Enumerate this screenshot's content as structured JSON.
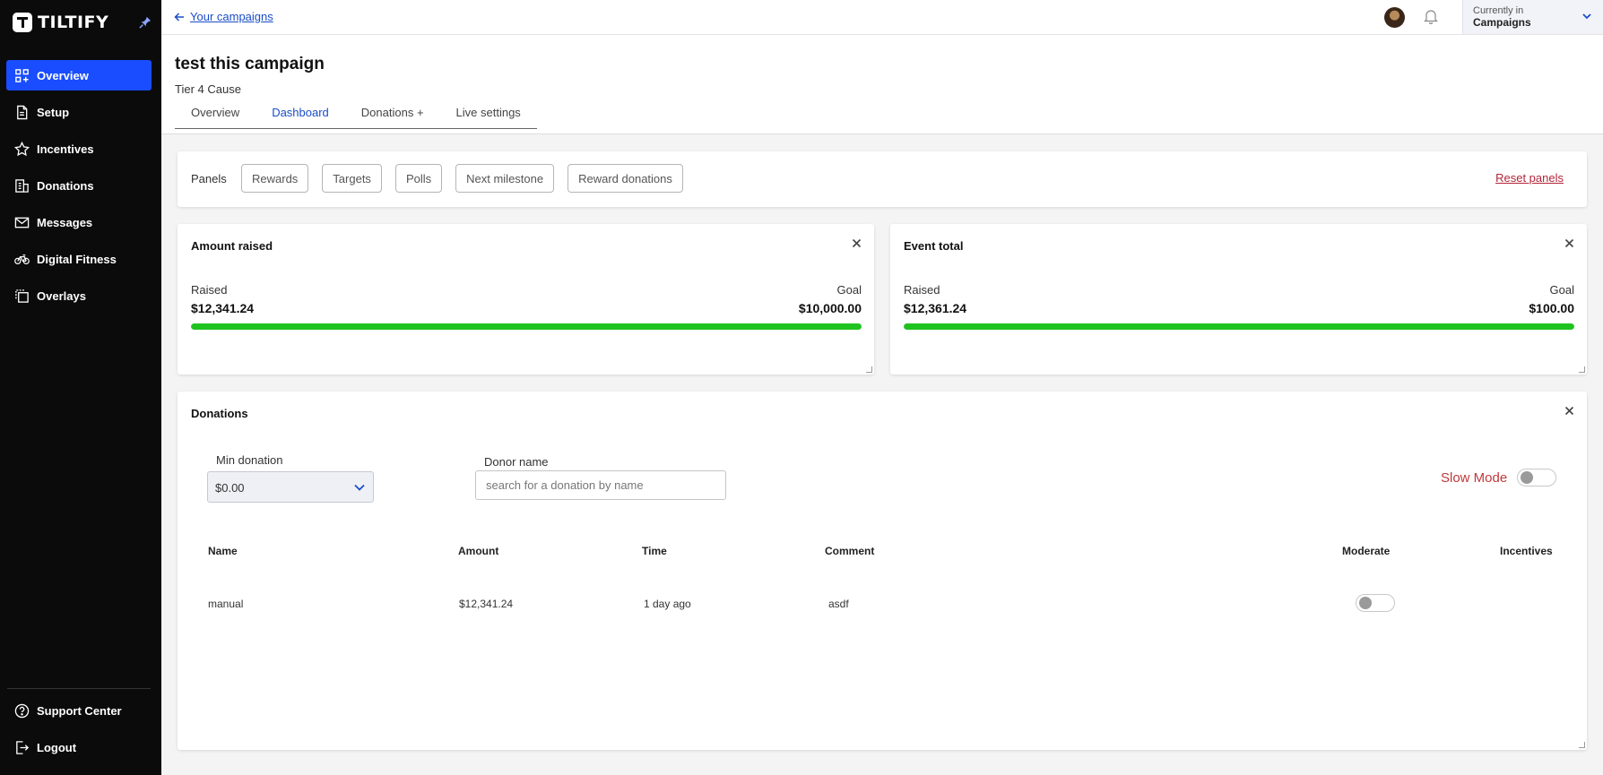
{
  "brand": {
    "name": "TILTIFY"
  },
  "sidebar": {
    "items": [
      {
        "label": "Overview",
        "icon": "grid-icon",
        "active": true
      },
      {
        "label": "Setup",
        "icon": "document-icon"
      },
      {
        "label": "Incentives",
        "icon": "star-icon"
      },
      {
        "label": "Donations",
        "icon": "donation-icon"
      },
      {
        "label": "Messages",
        "icon": "mail-icon"
      },
      {
        "label": "Digital Fitness",
        "icon": "bicycle-icon"
      },
      {
        "label": "Overlays",
        "icon": "overlay-icon"
      }
    ],
    "bottom": [
      {
        "label": "Support Center",
        "icon": "help-icon"
      },
      {
        "label": "Logout",
        "icon": "logout-icon"
      }
    ],
    "active_color": "#1a4dff"
  },
  "topbar": {
    "back_label": "Your campaigns",
    "context_small": "Currently in",
    "context_big": "Campaigns"
  },
  "header": {
    "title": "test this campaign",
    "subtitle": "Tier 4 Cause",
    "tabs": [
      {
        "label": "Overview"
      },
      {
        "label": "Dashboard",
        "active": true
      },
      {
        "label": "Donations +"
      },
      {
        "label": "Live settings"
      }
    ]
  },
  "panels": {
    "label": "Panels",
    "buttons": [
      "Rewards",
      "Targets",
      "Polls",
      "Next milestone",
      "Reward donations"
    ],
    "reset_label": "Reset panels"
  },
  "amount_raised": {
    "title": "Amount raised",
    "raised_label": "Raised",
    "goal_label": "Goal",
    "raised": "$12,341.24",
    "goal": "$10,000.00",
    "progress_percent": 100
  },
  "event_total": {
    "title": "Event total",
    "raised_label": "Raised",
    "goal_label": "Goal",
    "raised": "$12,361.24",
    "goal": "$100.00",
    "progress_percent": 100
  },
  "donations": {
    "title": "Donations",
    "min_label": "Min donation",
    "min_value": "$0.00",
    "donor_label": "Donor name",
    "donor_placeholder": "search for a donation by name",
    "slow_mode_label": "Slow Mode",
    "columns": [
      "Name",
      "Amount",
      "Time",
      "Comment",
      "Moderate",
      "Incentives"
    ],
    "rows": [
      {
        "name": "manual",
        "amount": "$12,341.24",
        "time": "1 day ago",
        "comment": "asdf",
        "moderate": false
      }
    ]
  },
  "colors": {
    "progress": "#1fc31f",
    "link": "#1a4dc8",
    "danger": "#b3263a"
  }
}
